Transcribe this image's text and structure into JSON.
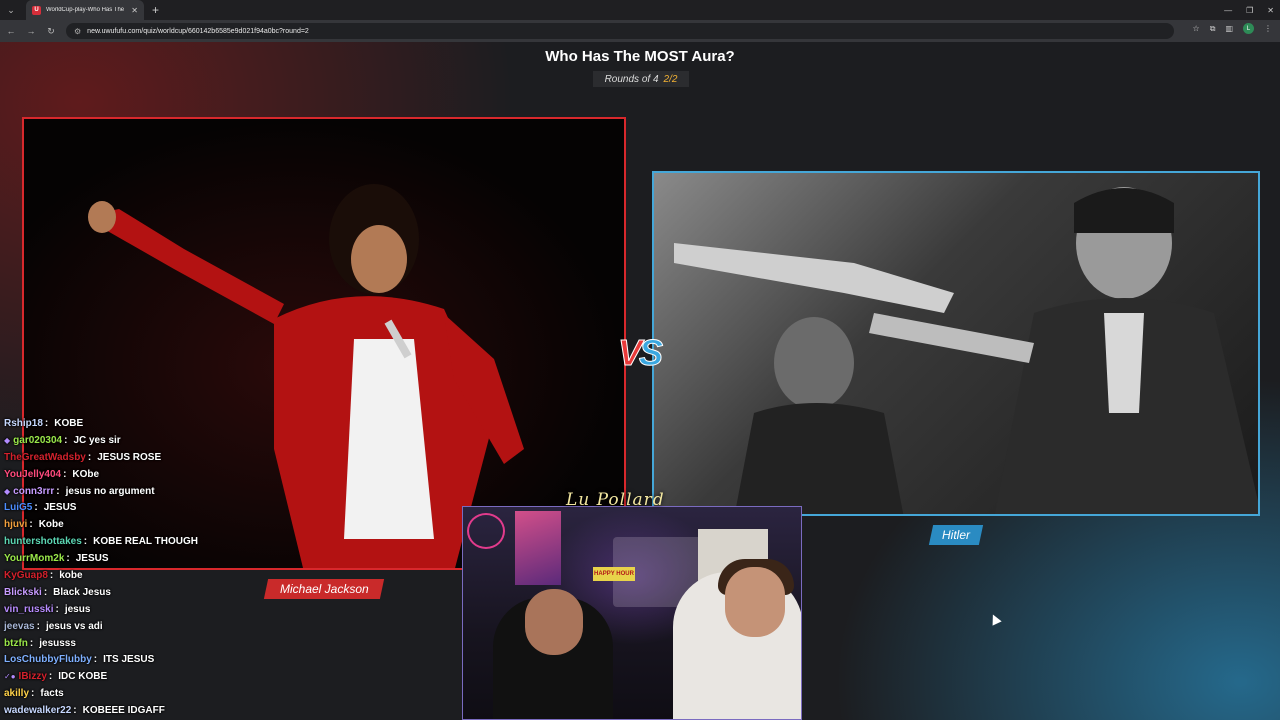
{
  "browser": {
    "tab_title": "WorldCup-play-Who Has The MOST Aura?",
    "url": "new.uwufufu.com/quiz/worldcup/660142b6585e9d021f94a0bc?round=2",
    "profile_initial": "L"
  },
  "quiz": {
    "title": "Who Has The MOST Aura?",
    "rounds_label": "Rounds of 4",
    "round_progress": "2/2",
    "left_label": "Michael Jackson",
    "right_label": "Hitler",
    "vs_v": "V",
    "vs_s": "S"
  },
  "signature": "Lu Pollard",
  "webcam_sign": "HAPPY HOUR",
  "chat": [
    {
      "user": "Rship18",
      "msg": "KOBE",
      "color": "#c7d8ff",
      "badge": ""
    },
    {
      "user": "gar020304",
      "msg": "JC yes sir",
      "color": "#9be84a",
      "badge": "◆"
    },
    {
      "user": "TheGreatWadsby",
      "msg": "JESUS ROSE",
      "color": "#d3212c",
      "badge": ""
    },
    {
      "user": "YouJelly404",
      "msg": "KObe",
      "color": "#ff4b7d",
      "badge": ""
    },
    {
      "user": "conn3rrr",
      "msg": "jesus no argument",
      "color": "#c79bff",
      "badge": "◆"
    },
    {
      "user": "LuiG5",
      "msg": "JESUS",
      "color": "#4c8dff",
      "badge": ""
    },
    {
      "user": "hjuvi",
      "msg": "Kobe",
      "color": "#f2a03d",
      "badge": ""
    },
    {
      "user": "huntershottakes",
      "msg": "KOBE REAL THOUGH",
      "color": "#5cd6b3",
      "badge": ""
    },
    {
      "user": "YourrMom2k",
      "msg": "JESUS",
      "color": "#9be84a",
      "badge": ""
    },
    {
      "user": "KyGuap8",
      "msg": "kobe",
      "color": "#d3212c",
      "badge": ""
    },
    {
      "user": "Blickski",
      "msg": "Black Jesus",
      "color": "#c79bff",
      "badge": ""
    },
    {
      "user": "vin_russki",
      "msg": "jesus",
      "color": "#b88cff",
      "badge": ""
    },
    {
      "user": "jeevas",
      "msg": "jesus vs adi",
      "color": "#a9b8d8",
      "badge": ""
    },
    {
      "user": "btzfn",
      "msg": "jesusss",
      "color": "#9be84a",
      "badge": ""
    },
    {
      "user": "LosChubbyFlubby",
      "msg": "ITS JESUS",
      "color": "#7fb0ff",
      "badge": ""
    },
    {
      "user": "IBizzy",
      "msg": "IDC KOBE",
      "color": "#d3212c",
      "badge": "✓●"
    },
    {
      "user": "akilly",
      "msg": "facts",
      "color": "#ffd24a",
      "badge": ""
    },
    {
      "user": "wadewalker22",
      "msg": "KOBEEE IDGAFF",
      "color": "#c7d8ff",
      "badge": ""
    }
  ]
}
